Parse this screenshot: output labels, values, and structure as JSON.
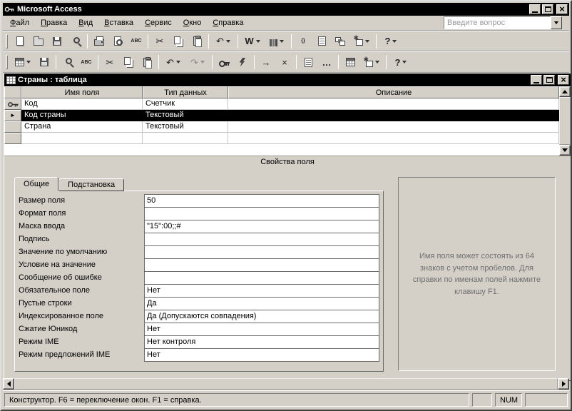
{
  "window": {
    "title": "Microsoft Access"
  },
  "menu": {
    "items": [
      "Файл",
      "Правка",
      "Вид",
      "Вставка",
      "Сервис",
      "Окно",
      "Справка"
    ],
    "question_placeholder": "Введите вопрос"
  },
  "icon_map": {
    "new-page": {
      "shape": "g-page"
    },
    "open-folder": {
      "shape": "g-folder"
    },
    "save-floppy": {
      "shape": "g-floppy"
    },
    "file-search": {
      "shape": "g-mag"
    },
    "print": {
      "shape": "g-print"
    },
    "print-preview": {
      "shape": "g-preview"
    },
    "spelling": {
      "text": "ABC"
    },
    "cut": {
      "glyph": "✂"
    },
    "copy": {
      "shape": "g-copy"
    },
    "paste": {
      "shape": "g-paste"
    },
    "undo": {
      "glyph": "↶"
    },
    "redo": {
      "glyph": "↷"
    },
    "office-links": {
      "glyph": "W",
      "bold": true
    },
    "analyze": {
      "shape": "g-bars"
    },
    "code": {
      "text": "{}"
    },
    "properties": {
      "shape": "g-prop"
    },
    "relationships": {
      "shape": "g-rel"
    },
    "new-object": {
      "shape": "g-newobj"
    },
    "help": {
      "glyph": "?",
      "bold": true
    },
    "view-datasheet": {
      "shape": "g-grid"
    },
    "primary-key": {
      "shape": "g-key"
    },
    "indexes": {
      "shape": "g-bolt"
    },
    "insert-rows": {
      "glyph": "→"
    },
    "delete-rows": {
      "glyph": "×"
    },
    "builder": {
      "glyph": "…",
      "bold": true
    },
    "database-window": {
      "shape": "g-grid"
    }
  },
  "toolbars": {
    "standard": [
      {
        "icon": "new-page"
      },
      {
        "icon": "open-folder"
      },
      {
        "icon": "save-floppy"
      },
      {
        "icon": "file-search"
      },
      {
        "sep": true
      },
      {
        "icon": "print"
      },
      {
        "icon": "print-preview"
      },
      {
        "icon": "spelling"
      },
      {
        "sep": true
      },
      {
        "icon": "cut"
      },
      {
        "icon": "copy"
      },
      {
        "icon": "paste"
      },
      {
        "sep": true
      },
      {
        "icon": "undo",
        "dropdown": true
      },
      {
        "sep": true
      },
      {
        "icon": "office-links",
        "dropdown": true
      },
      {
        "icon": "analyze",
        "dropdown": true
      },
      {
        "sep": true
      },
      {
        "icon": "code"
      },
      {
        "icon": "properties"
      },
      {
        "icon": "relationships"
      },
      {
        "icon": "new-object",
        "dropdown": true
      },
      {
        "sep": true
      },
      {
        "icon": "help",
        "dropdown": true
      }
    ],
    "table_design": [
      {
        "icon": "view-datasheet",
        "dropdown": true
      },
      {
        "icon": "save-floppy"
      },
      {
        "sep": true
      },
      {
        "icon": "file-search"
      },
      {
        "icon": "spelling"
      },
      {
        "sep": true
      },
      {
        "icon": "cut"
      },
      {
        "icon": "copy"
      },
      {
        "icon": "paste"
      },
      {
        "sep": true
      },
      {
        "icon": "undo",
        "dropdown": true
      },
      {
        "icon": "redo",
        "dropdown": true,
        "disabled": true
      },
      {
        "sep": true
      },
      {
        "icon": "primary-key"
      },
      {
        "icon": "indexes"
      },
      {
        "sep": true
      },
      {
        "icon": "insert-rows"
      },
      {
        "icon": "delete-rows"
      },
      {
        "sep": true
      },
      {
        "icon": "properties"
      },
      {
        "icon": "builder"
      },
      {
        "sep": true
      },
      {
        "icon": "database-window"
      },
      {
        "icon": "new-object",
        "dropdown": true
      },
      {
        "sep": true
      },
      {
        "icon": "help",
        "dropdown": true
      }
    ]
  },
  "document": {
    "title": "Страны : таблица"
  },
  "grid": {
    "headers": [
      "Имя поля",
      "Тип данных",
      "Описание"
    ],
    "rows": [
      {
        "name": "Код",
        "type": "Счетчик",
        "desc": "",
        "marker": "key",
        "selected": false
      },
      {
        "name": "Код страны",
        "type": "Текстовый",
        "desc": "",
        "marker": "current",
        "selected": true
      },
      {
        "name": "Страна",
        "type": "Текстовый",
        "desc": "",
        "selected": false
      },
      {
        "name": "",
        "type": "",
        "desc": "",
        "selected": false
      }
    ]
  },
  "properties": {
    "caption": "Свойства поля",
    "tabs": [
      "Общие",
      "Подстановка"
    ],
    "active_tab_index": 0,
    "rows": [
      {
        "label": "Размер поля",
        "value": "50"
      },
      {
        "label": "Формат поля",
        "value": ""
      },
      {
        "label": "Маска ввода",
        "value": "\"15\":00;;#"
      },
      {
        "label": "Подпись",
        "value": ""
      },
      {
        "label": "Значение по умолчанию",
        "value": ""
      },
      {
        "label": "Условие на значение",
        "value": ""
      },
      {
        "label": "Сообщение об ошибке",
        "value": ""
      },
      {
        "label": "Обязательное поле",
        "value": "Нет"
      },
      {
        "label": "Пустые строки",
        "value": "Да"
      },
      {
        "label": "Индексированное поле",
        "value": "Да (Допускаются совпадения)"
      },
      {
        "label": "Сжатие Юникод",
        "value": "Нет"
      },
      {
        "label": "Режим IME",
        "value": "Нет контроля"
      },
      {
        "label": "Режим предложений IME",
        "value": "Нет"
      }
    ],
    "help": "Имя поля может состоять из 64 знаков с учетом пробелов.  Для справки по именам полей нажмите клавишу F1."
  },
  "status": {
    "message": "Конструктор.  F6 = переключение окон.  F1 = справка.",
    "num": "NUM"
  }
}
